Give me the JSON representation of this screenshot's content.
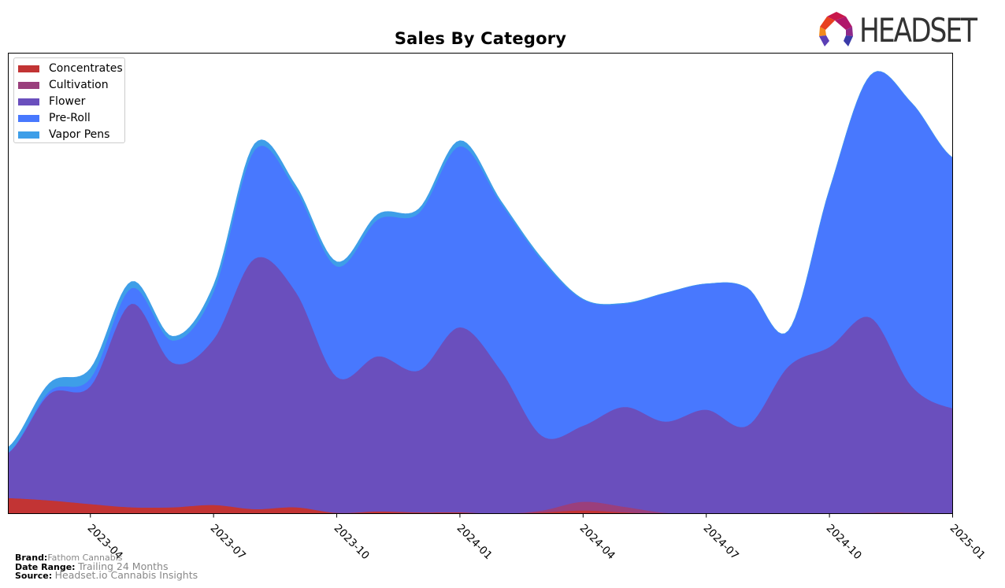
{
  "logo": {
    "text": "HEADSET"
  },
  "footer": {
    "brand_label": "Brand:",
    "brand_value": "Fathom Cannabis",
    "date_label": "Date Range:",
    "date_value": "Trailing 24 Months",
    "source_label": "Source:",
    "source_value": "Headset.io Cannabis Insights"
  },
  "chart_data": {
    "type": "area",
    "stacked": true,
    "smoothed": true,
    "title": "Sales By Category",
    "xlabel": "",
    "ylabel": "",
    "y_units": "relative sales (unlabeled axis, 0-100 scale of plot height)",
    "ylim": [
      0,
      100
    ],
    "grid": false,
    "legend_position": "top-left",
    "x": [
      "2023-02",
      "2023-03",
      "2023-04",
      "2023-05",
      "2023-06",
      "2023-07",
      "2023-08",
      "2023-09",
      "2023-10",
      "2023-11",
      "2023-12",
      "2024-01",
      "2024-02",
      "2024-03",
      "2024-04",
      "2024-05",
      "2024-06",
      "2024-07",
      "2024-08",
      "2024-09",
      "2024-10",
      "2024-11",
      "2024-12",
      "2025-01"
    ],
    "x_ticks": [
      "2023-04",
      "2023-07",
      "2023-10",
      "2024-01",
      "2024-04",
      "2024-07",
      "2024-10",
      "2025-01"
    ],
    "series": [
      {
        "name": "Concentrates",
        "color": "#c23434",
        "values": [
          3.4,
          2.9,
          2.1,
          1.4,
          1.4,
          1.9,
          1.0,
          1.4,
          0.2,
          0.5,
          0.3,
          0.3,
          0.0,
          0.3,
          0.7,
          0.3,
          0.0,
          0.0,
          0.0,
          0.0,
          0.0,
          0.2,
          0.2,
          0.1
        ]
      },
      {
        "name": "Cultivation",
        "color": "#9a3f7c",
        "values": [
          0,
          0,
          0,
          0,
          0,
          0,
          0,
          0,
          0,
          0,
          0,
          0,
          0,
          0.4,
          1.9,
          1.2,
          0.2,
          0,
          0,
          0,
          0,
          0,
          0,
          0
        ]
      },
      {
        "name": "Flower",
        "color": "#6a4fbd",
        "values": [
          9.8,
          23.1,
          25.6,
          44.2,
          31.4,
          36.0,
          54.4,
          46.8,
          29.5,
          33.7,
          30.8,
          40.2,
          31.1,
          16.2,
          16.5,
          21.7,
          19.8,
          22.6,
          19.1,
          32.0,
          36.2,
          42.4,
          27.5,
          22.8
        ]
      },
      {
        "name": "Pre-Roll",
        "color": "#4878fe",
        "values": [
          0.1,
          0.6,
          1.7,
          3.4,
          4.8,
          10.3,
          23.6,
          22.2,
          24.0,
          29.7,
          34.2,
          39.3,
          36.3,
          38.1,
          27.4,
          22.4,
          27.9,
          27.3,
          29.9,
          7.7,
          34.2,
          52.6,
          61.5,
          54.4
        ]
      },
      {
        "name": "Vapor Pens",
        "color": "#3e9ee8",
        "values": [
          1.1,
          1.7,
          2.1,
          1.4,
          0.9,
          1.4,
          1.3,
          0.9,
          1.0,
          1.1,
          0.9,
          1.2,
          0.5,
          0.4,
          0.1,
          0.1,
          0.0,
          0.0,
          0.0,
          0.0,
          0.0,
          0.0,
          0.0,
          0.0
        ]
      }
    ]
  }
}
